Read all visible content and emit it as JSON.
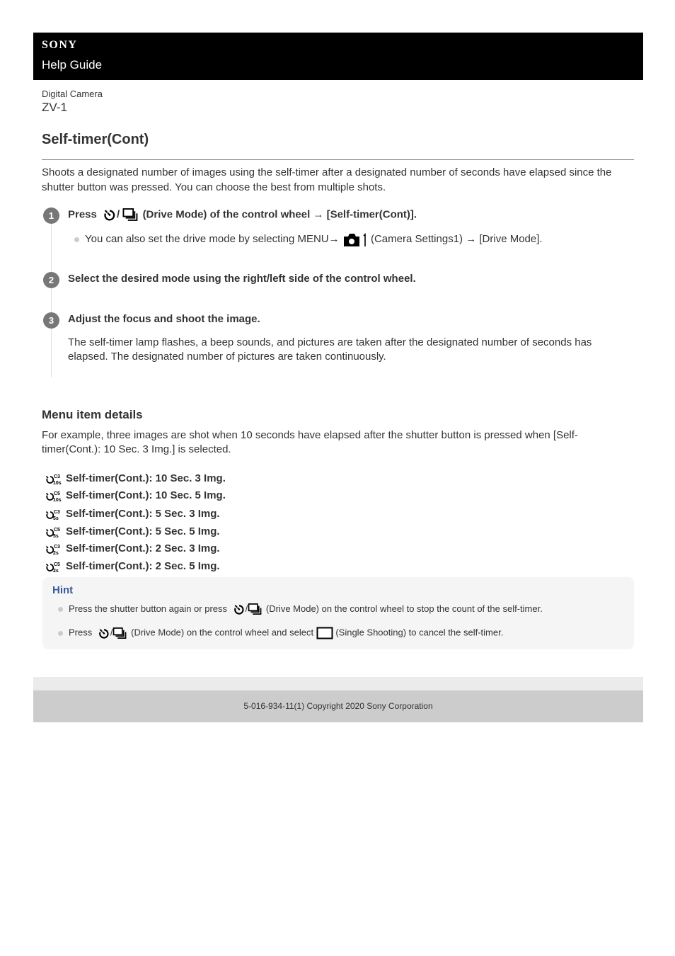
{
  "header": {
    "brand": "SONY",
    "title": "Help Guide"
  },
  "product": {
    "type": "Digital Camera",
    "model": "ZV-1"
  },
  "page_title": "Self-timer(Cont)",
  "intro": "Shoots a designated number of images using the self-timer after a designated number of seconds have elapsed since the shutter button was pressed. You can choose the best from multiple shots.",
  "steps": [
    {
      "number": "1",
      "pre": "Press",
      "post": "(Drive Mode) of the control wheel → [Self-timer(Cont)].",
      "sub_pre": "You can also set the drive mode by selecting MENU→",
      "sub_post": "(Camera Settings1) → [Drive Mode].",
      "icons": [
        "self-timer-icon",
        "continuous-shooting-icon",
        "camera-settings1-icon"
      ]
    },
    {
      "number": "2",
      "text": "Select the desired mode using the right/left side of the control wheel."
    },
    {
      "number": "3",
      "text": "Adjust the focus and shoot the image.",
      "body": "The self-timer lamp flashes, a beep sounds, and pictures are taken after the designated number of seconds has elapsed. The designated number of pictures are taken continuously."
    }
  ],
  "menu_details": {
    "heading": "Menu item details",
    "description": "For example, three images are shot when 10 seconds have elapsed after the shutter button is pressed when [Self-timer(Cont.): 10 Sec. 3 Img.] is selected.",
    "items": [
      {
        "label": "Self-timer(Cont.): 10 Sec. 3 Img.",
        "icon_top": "C3",
        "icon_bottom": "10s"
      },
      {
        "label": "Self-timer(Cont.): 10 Sec. 5 Img.",
        "icon_top": "C5",
        "icon_bottom": "10s"
      },
      {
        "label": "Self-timer(Cont.): 5 Sec. 3 Img.",
        "icon_top": "C3",
        "icon_bottom": "5s"
      },
      {
        "label": "Self-timer(Cont.): 5 Sec. 5 Img.",
        "icon_top": "C5",
        "icon_bottom": "5s"
      },
      {
        "label": "Self-timer(Cont.): 2 Sec. 3 Img.",
        "icon_top": "C3",
        "icon_bottom": "2s"
      },
      {
        "label": "Self-timer(Cont.): 2 Sec. 5 Img.",
        "icon_top": "C5",
        "icon_bottom": "2s"
      }
    ]
  },
  "hint": {
    "title": "Hint",
    "items": [
      {
        "pre": "Press the shutter button again or press",
        "post": "(Drive Mode) on the control wheel to stop the count of the self-timer."
      },
      {
        "pre": "Press",
        "mid": "(Drive Mode) on the control wheel and select",
        "post": "(Single Shooting) to cancel the self-timer."
      }
    ]
  },
  "footer": {
    "copyright": "5-016-934-11(1) Copyright 2020 Sony Corporation"
  },
  "colors": {
    "header_bg": "#000000",
    "hint_title": "#3a5a9a",
    "step_badge": "#777777",
    "footer_bg": "#cccccc"
  }
}
